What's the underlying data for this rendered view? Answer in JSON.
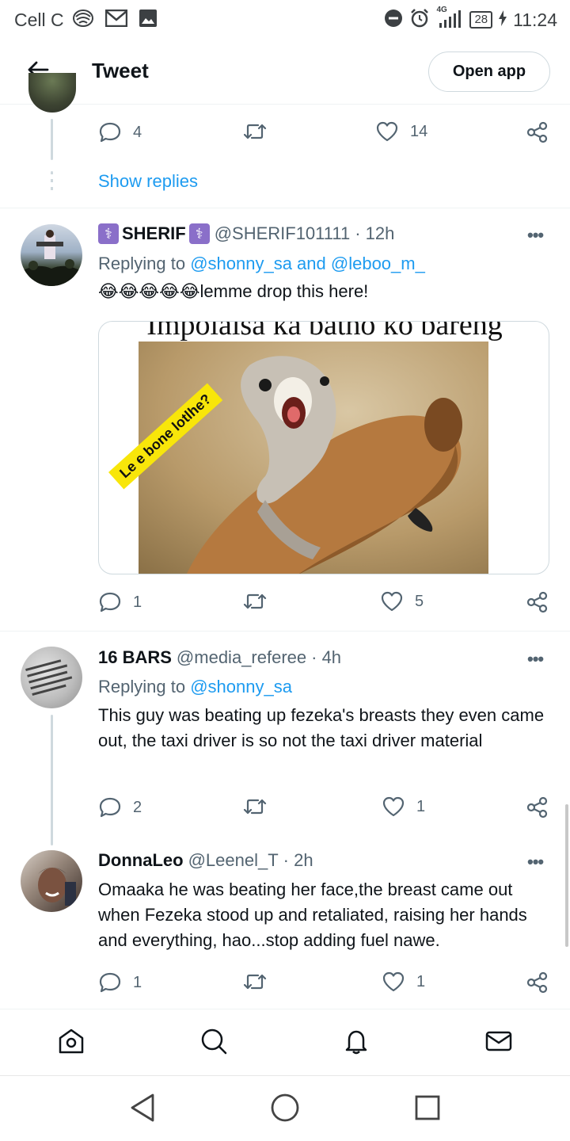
{
  "status_bar": {
    "carrier": "Cell C",
    "network": "4G",
    "battery": "28",
    "time": "11:24",
    "icons": [
      "carrier-logo-icon",
      "mail-icon",
      "gallery-icon",
      "do-not-disturb-icon",
      "alarm-icon",
      "signal-icon",
      "charging-icon"
    ]
  },
  "header": {
    "title": "Tweet",
    "open_app_label": "Open app",
    "back_icon": "arrow-left-icon"
  },
  "previous_tweet": {
    "reply_count": "4",
    "like_count": "14",
    "show_replies": "Show replies"
  },
  "tweets": [
    {
      "name": "SHERIF",
      "name_prefix_emoji": "⚕️",
      "name_suffix_emoji": "⚕️",
      "handle": "@SHERIF101111",
      "time": "· 12h",
      "replying_prefix": "Replying to",
      "replying_to": "@shonny_sa and @leboo_m_",
      "emojis": "😂😂😂😂😂",
      "text": "lemme drop this here!",
      "media": {
        "top_caption": "Impolaisa ka batho ko bareng",
        "sticker": "Le e bone lotlhe?"
      },
      "reply_count": "1",
      "like_count": "5"
    },
    {
      "name": "16 BARS",
      "handle": "@media_referee",
      "time": "· 4h",
      "replying_prefix": "Replying to",
      "replying_to": "@shonny_sa",
      "text": "This guy was beating up fezeka's breasts they even came out, the taxi driver is so not the taxi driver material",
      "reply_count": "2",
      "like_count": "1"
    },
    {
      "name": "DonnaLeo",
      "handle": "@Leenel_T",
      "time": "· 2h",
      "text": "Omaaka he was beating her face,the breast came out when Fezeka stood up and retaliated, raising her hands and everything, hao...stop adding fuel nawe.",
      "reply_count": "1",
      "like_count": "1"
    }
  ],
  "bottom_nav": [
    "home-icon",
    "search-icon",
    "notifications-icon",
    "messages-icon"
  ],
  "system_nav": [
    "back-triangle-icon",
    "home-circle-icon",
    "recents-square-icon"
  ],
  "colors": {
    "accent": "#1d9bf0",
    "text": "#0f1419",
    "secondary": "#536471",
    "border": "#cfd9de"
  }
}
